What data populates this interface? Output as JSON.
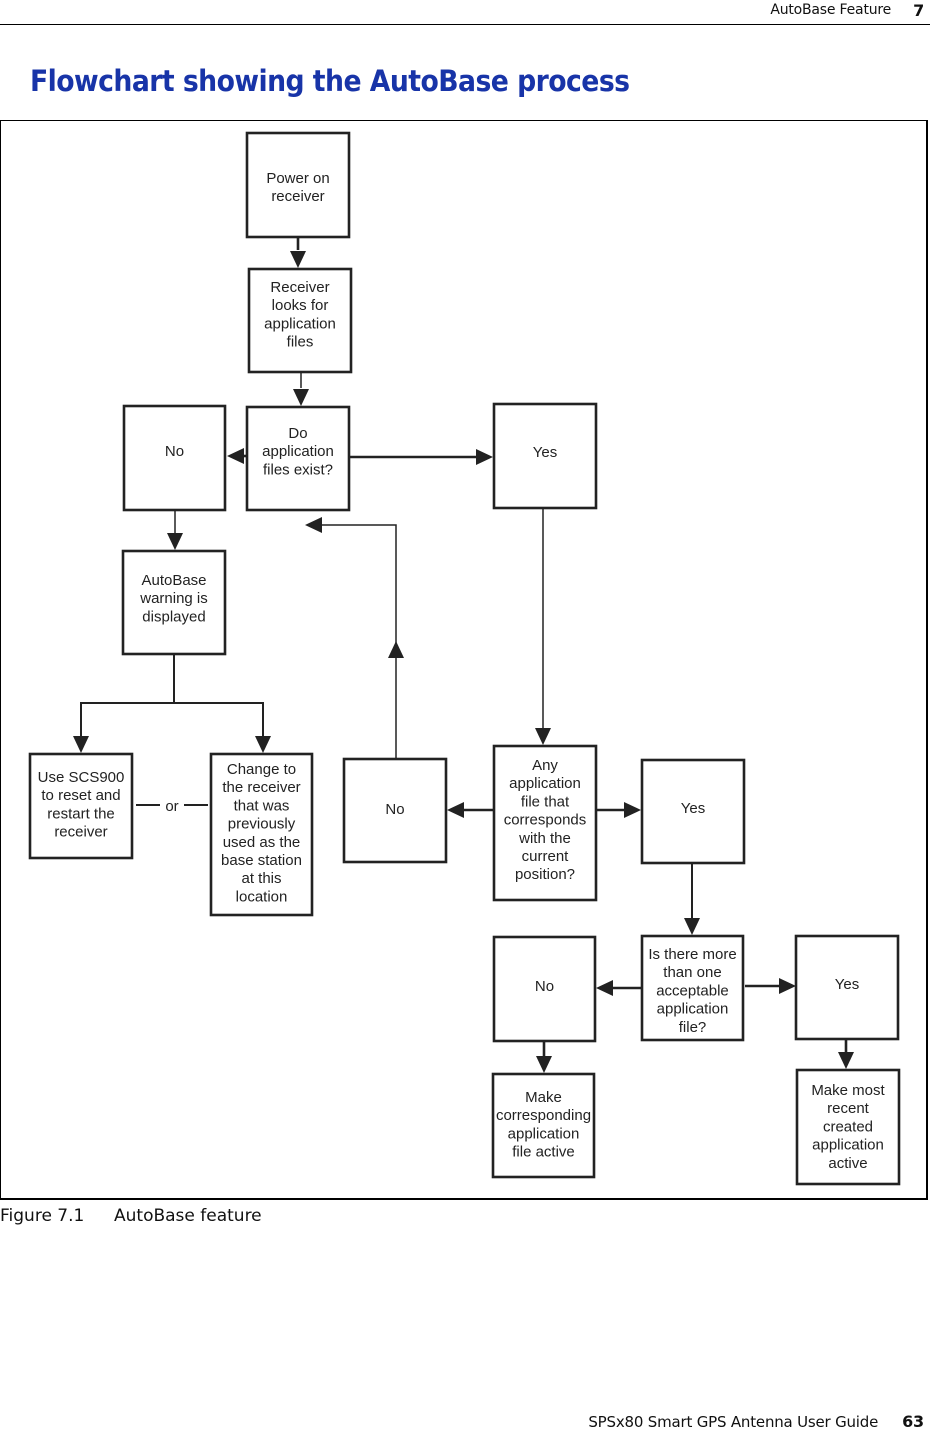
{
  "header": {
    "section": "AutoBase Feature",
    "chapter": "7"
  },
  "page_title": "Flowchart showing the AutoBase process",
  "figure": {
    "number": "Figure 7.1",
    "caption": "AutoBase feature"
  },
  "footer": {
    "guide_title": "SPSx80 Smart GPS Antenna User Guide",
    "page": "63"
  },
  "colors": {
    "title": "#1834a8",
    "ink": "#222222"
  },
  "flowchart": {
    "nodes": [
      {
        "id": "power-on",
        "name": "node-power-on-receiver",
        "lines": [
          "Power on",
          "receiver"
        ]
      },
      {
        "id": "looks",
        "name": "node-receiver-looks-for-files",
        "lines": [
          "Receiver",
          "looks for",
          "application",
          "files"
        ]
      },
      {
        "id": "exist",
        "name": "node-do-files-exist",
        "lines": [
          "Do",
          "application",
          "files exist?"
        ]
      },
      {
        "id": "no1",
        "name": "node-no-files",
        "lines": [
          "No"
        ]
      },
      {
        "id": "yes1",
        "name": "node-yes-files",
        "lines": [
          "Yes"
        ]
      },
      {
        "id": "warning",
        "name": "node-autobase-warning",
        "lines": [
          "AutoBase",
          "warning is",
          "displayed"
        ]
      },
      {
        "id": "reset",
        "name": "node-use-scs900-reset",
        "lines": [
          "Use SCS900",
          "to reset and",
          "restart the",
          "receiver"
        ]
      },
      {
        "id": "change",
        "name": "node-change-receiver",
        "lines": [
          "Change to",
          "the receiver",
          "that was",
          "previously",
          "used as the",
          "base station",
          "at this",
          "location"
        ]
      },
      {
        "id": "no2",
        "name": "node-no-corresponding",
        "lines": [
          "No"
        ]
      },
      {
        "id": "corresponds",
        "name": "node-any-file-corresponds",
        "lines": [
          "Any",
          "application",
          "file that",
          "corresponds",
          "with the",
          "current",
          "position?"
        ]
      },
      {
        "id": "yes2",
        "name": "node-yes-corresponding",
        "lines": [
          "Yes"
        ]
      },
      {
        "id": "no3",
        "name": "node-no-multiple",
        "lines": [
          "No"
        ]
      },
      {
        "id": "more-than-one",
        "name": "node-more-than-one-file",
        "lines": [
          "Is there more",
          "than one",
          "acceptable",
          "application",
          "file?"
        ]
      },
      {
        "id": "yes3",
        "name": "node-yes-multiple",
        "lines": [
          "Yes"
        ]
      },
      {
        "id": "make-corresponding",
        "name": "node-make-corresponding-active",
        "lines": [
          "Make",
          "corresponding",
          "application",
          "file active"
        ]
      },
      {
        "id": "make-recent",
        "name": "node-make-most-recent-active",
        "lines": [
          "Make most",
          "recent",
          "created",
          "application",
          "active"
        ]
      }
    ],
    "edges": [
      {
        "from": "power-on",
        "to": "looks"
      },
      {
        "from": "looks",
        "to": "exist"
      },
      {
        "from": "exist",
        "to": "no1"
      },
      {
        "from": "exist",
        "to": "yes1"
      },
      {
        "from": "no1",
        "to": "warning"
      },
      {
        "from": "warning",
        "to": "reset"
      },
      {
        "from": "warning",
        "to": "change"
      },
      {
        "from": "yes1",
        "to": "corresponds"
      },
      {
        "from": "corresponds",
        "to": "no2"
      },
      {
        "from": "corresponds",
        "to": "yes2"
      },
      {
        "from": "no2",
        "to": "warning"
      },
      {
        "from": "yes2",
        "to": "more-than-one"
      },
      {
        "from": "more-than-one",
        "to": "no3"
      },
      {
        "from": "more-than-one",
        "to": "yes3"
      },
      {
        "from": "no3",
        "to": "make-corresponding"
      },
      {
        "from": "yes3",
        "to": "make-recent"
      }
    ],
    "or_connector": {
      "between": [
        "reset",
        "change"
      ],
      "label": "or"
    }
  }
}
